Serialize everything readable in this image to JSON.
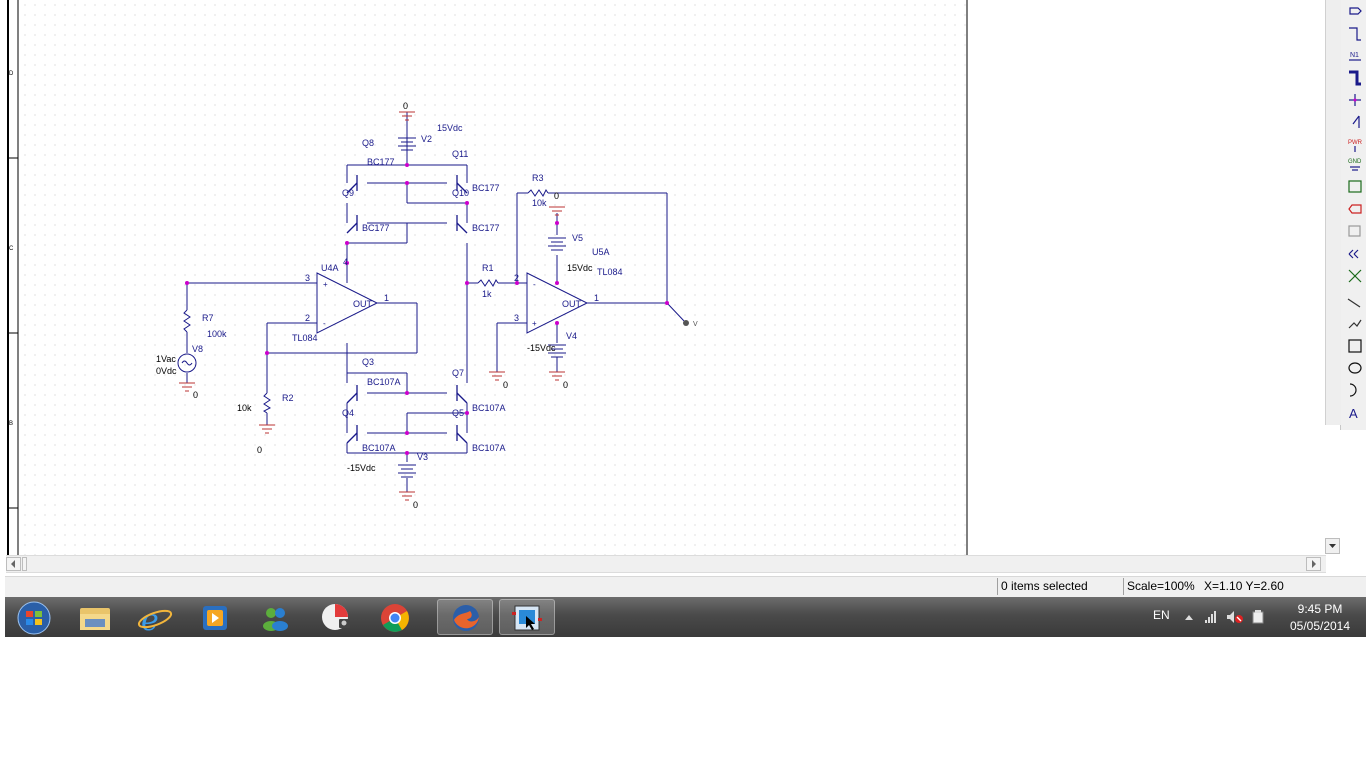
{
  "schematic": {
    "labels": {
      "q8": "Q8",
      "v2": "V2",
      "v2_val": "15Vdc",
      "gnd_top": "0",
      "q11": "Q11",
      "bc177_a": "BC177",
      "q9": "Q9",
      "q10": "Q10",
      "bc177_b": "BC177",
      "bc177_c": "BC177",
      "bc177_d": "BC177",
      "u4a": "U4A",
      "tl084_a": "TL084",
      "out_a": "OUT",
      "pin1_a": "1",
      "pin2_a": "2",
      "pin3_a": "3",
      "pin4_a": "4",
      "r7": "R7",
      "r7_val": "100k",
      "v8": "V8",
      "v8_ac": "1Vac",
      "v8_dc": "0Vdc",
      "gnd_v8": "0",
      "r2": "R2",
      "r2_val": "10k",
      "gnd_r2": "0",
      "q3": "Q3",
      "bc107a_a": "BC107A",
      "q7": "Q7",
      "q4": "Q4",
      "q5": "Q5",
      "bc107a_b": "BC107A",
      "bc107a_c": "BC107A",
      "bc107a_d": "BC107A",
      "v3": "V3",
      "v3_val": "-15Vdc",
      "gnd_v3": "0",
      "r1": "R1",
      "r1_val": "1k",
      "r3": "R3",
      "r3_val": "10k",
      "gnd_r3": "0",
      "v5": "V5",
      "v5_val": "15Vdc",
      "u5a": "U5A",
      "tl084_b": "TL084",
      "out_b": "OUT",
      "pin1_b": "1",
      "pin2_b": "2",
      "pin3_b": "3",
      "v4": "V4",
      "v4_val": "-15Vdc",
      "gnd_v4": "0",
      "gnd_u5": "0",
      "probe": "V"
    }
  },
  "toolbar": {
    "tools": [
      "select-tool",
      "wire-tool",
      "net-alias-tool",
      "bus-tool",
      "junction-tool",
      "bus-entry-tool",
      "power-tool",
      "ground-tool",
      "hierarchical-block-tool",
      "port-tool",
      "pin-tool",
      "off-page-connector-tool",
      "no-connect-tool",
      "line-tool",
      "polyline-tool",
      "rectangle-tool",
      "ellipse-tool",
      "arc-tool",
      "text-tool"
    ],
    "net_alias_label": "N1",
    "pwr_label": "PWR",
    "gnd_label": "GND"
  },
  "status": {
    "selection": "0 items selected",
    "scale": "Scale=100%",
    "coords": "X=1.10  Y=2.60"
  },
  "taskbar": {
    "apps": [
      "start-button",
      "file-explorer",
      "internet-explorer",
      "media-player",
      "messenger",
      "media-center",
      "chrome",
      "firefox",
      "orcad-capture"
    ],
    "lang": "EN",
    "time": "9:45 PM",
    "date": "05/05/2014"
  },
  "colors": {
    "wire": "#1a1a8a",
    "part": "#1a1a8a",
    "junction": "#cc00cc",
    "ground": "#b33",
    "grid": "#c9c9c9"
  }
}
